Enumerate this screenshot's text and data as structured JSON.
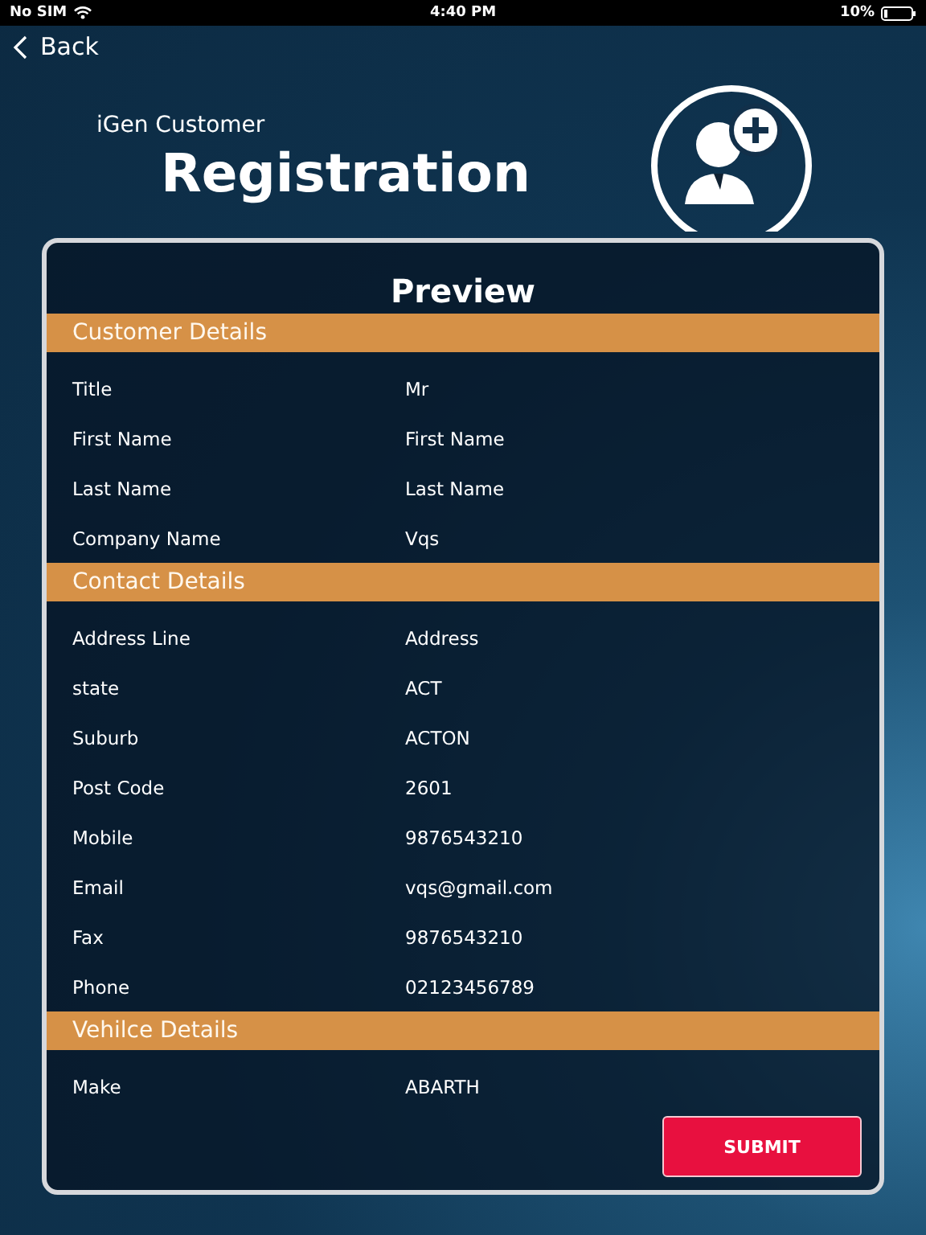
{
  "status_bar": {
    "carrier": "No SIM",
    "time": "4:40 PM",
    "battery": "10%"
  },
  "nav": {
    "back": "Back"
  },
  "header": {
    "subtitle": "iGen Customer",
    "title": "Registration"
  },
  "card": {
    "title": "Preview",
    "sections": [
      {
        "title": "Customer Details",
        "rows": [
          {
            "label": "Title",
            "value": "Mr"
          },
          {
            "label": "First Name",
            "value": "First Name"
          },
          {
            "label": "Last Name",
            "value": "Last Name"
          },
          {
            "label": "Company Name",
            "value": "Vqs"
          }
        ]
      },
      {
        "title": "Contact Details",
        "rows": [
          {
            "label": "Address Line",
            "value": "Address"
          },
          {
            "label": "state",
            "value": "ACT"
          },
          {
            "label": "Suburb",
            "value": "ACTON"
          },
          {
            "label": "Post Code",
            "value": "2601"
          },
          {
            "label": "Mobile",
            "value": "9876543210"
          },
          {
            "label": "Email",
            "value": "vqs@gmail.com"
          },
          {
            "label": "Fax",
            "value": "9876543210"
          },
          {
            "label": "Phone",
            "value": "02123456789"
          }
        ]
      },
      {
        "title": "Vehilce Details",
        "rows": [
          {
            "label": "Make",
            "value": "ABARTH"
          }
        ]
      }
    ],
    "submit": "SUBMIT"
  }
}
